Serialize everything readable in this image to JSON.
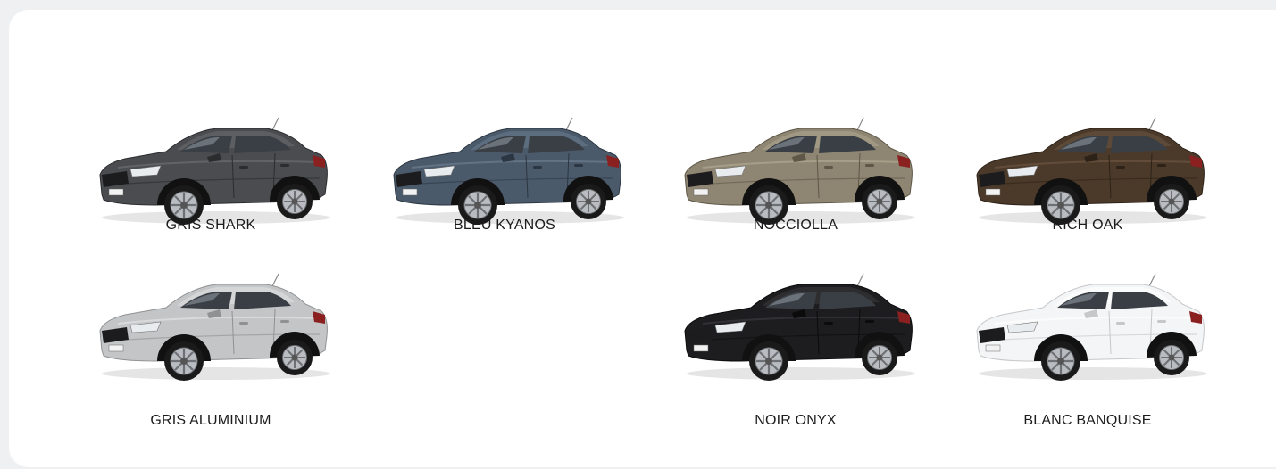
{
  "swatches": [
    {
      "name": "GRIS SHARK",
      "color": "#4a4c4f",
      "shade": "#2b2c2e",
      "highlight": "#6b6e72"
    },
    {
      "name": "BLEU KYANOS",
      "color": "#4b5a6b",
      "shade": "#2c3642",
      "highlight": "#6c7d90"
    },
    {
      "name": "NOCCIOLLA",
      "color": "#8e8572",
      "shade": "#5e5747",
      "highlight": "#b1a892"
    },
    {
      "name": "RICH OAK",
      "color": "#4b3a2a",
      "shade": "#2d2218",
      "highlight": "#6d5641"
    },
    {
      "name": "GRIS ALUMINIUM",
      "color": "#c3c5c7",
      "shade": "#8f9193",
      "highlight": "#e2e3e4"
    },
    {
      "name": "NOIR ONYX",
      "color": "#1d1d1f",
      "shade": "#0b0b0c",
      "highlight": "#3b3b3e"
    },
    {
      "name": "BLANC BANQUISE",
      "color": "#f4f5f6",
      "shade": "#c5c7c9",
      "highlight": "#ffffff"
    }
  ]
}
